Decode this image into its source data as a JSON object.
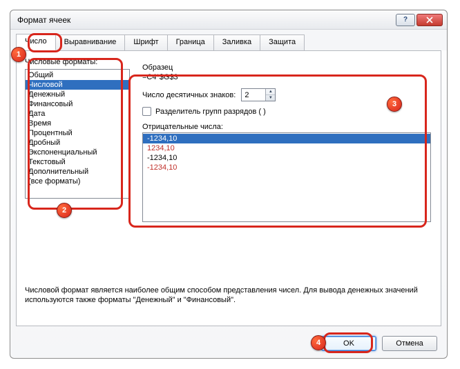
{
  "window": {
    "title": "Формат ячеек"
  },
  "tabs": [
    {
      "label": "Число",
      "active": true
    },
    {
      "label": "Выравнивание",
      "active": false
    },
    {
      "label": "Шрифт",
      "active": false
    },
    {
      "label": "Граница",
      "active": false
    },
    {
      "label": "Заливка",
      "active": false
    },
    {
      "label": "Защита",
      "active": false
    }
  ],
  "number_tab": {
    "categories_label": "Числовые форматы:",
    "categories": [
      {
        "label": "Общий"
      },
      {
        "label": "Числовой",
        "selected": true
      },
      {
        "label": "Денежный"
      },
      {
        "label": "Финансовый"
      },
      {
        "label": "Дата"
      },
      {
        "label": "Время"
      },
      {
        "label": "Процентный"
      },
      {
        "label": "Дробный"
      },
      {
        "label": "Экспоненциальный"
      },
      {
        "label": "Текстовый"
      },
      {
        "label": "Дополнительный"
      },
      {
        "label": "(все форматы)"
      }
    ],
    "sample_label": "Образец",
    "sample_value": "=C4*$G$3",
    "decimal_label": "Число десятичных знаков:",
    "decimal_value": "2",
    "thousands_label": "Разделитель групп разрядов ( )",
    "thousands_checked": false,
    "negative_label": "Отрицательные числа:",
    "negative_options": [
      {
        "text": "-1234,10",
        "color": "black",
        "selected": true
      },
      {
        "text": "1234,10",
        "color": "red"
      },
      {
        "text": "-1234,10",
        "color": "black"
      },
      {
        "text": "-1234,10",
        "color": "red"
      }
    ],
    "description": "Числовой формат является наиболее общим способом представления чисел. Для вывода денежных значений используются также форматы \"Денежный\" и \"Финансовый\"."
  },
  "footer": {
    "ok": "OK",
    "cancel": "Отмена"
  },
  "annotations": {
    "b1": "1",
    "b2": "2",
    "b3": "3",
    "b4": "4"
  }
}
